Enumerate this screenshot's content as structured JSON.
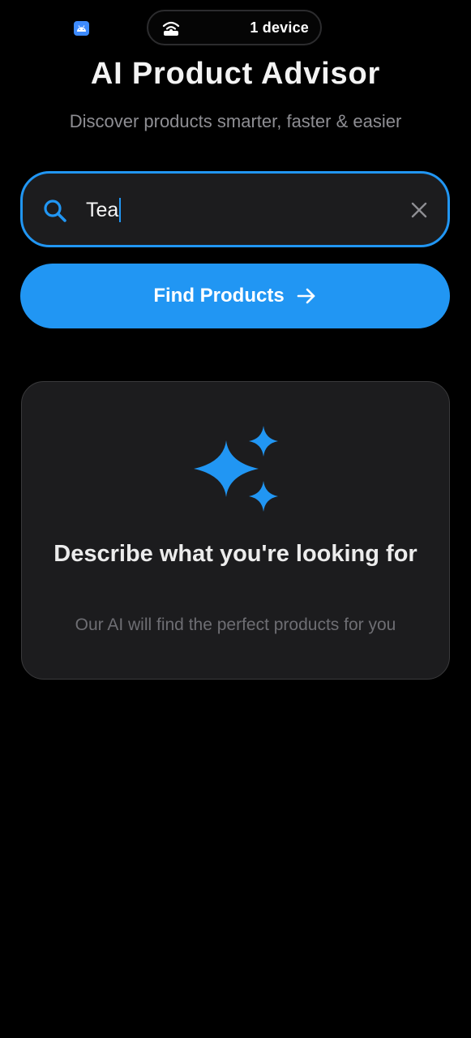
{
  "status_bar": {
    "app_icon": "android-app-icon",
    "hotspot_icon": "hotspot-icon",
    "device_count": "1 device"
  },
  "header": {
    "title": "AI Product Advisor",
    "subtitle": "Discover products smarter, faster & easier"
  },
  "search": {
    "value": "Tea",
    "icon": "search-icon",
    "clear_icon": "close-icon"
  },
  "find_button": {
    "label": "Find Products",
    "icon": "arrow-right-icon"
  },
  "prompt_card": {
    "icon": "sparkles-icon",
    "heading": "Describe what you're looking for",
    "text": "Our AI will find the perfect products for you"
  },
  "colors": {
    "accent": "#2196f3",
    "background": "#000000",
    "surface": "#1c1c1e"
  }
}
